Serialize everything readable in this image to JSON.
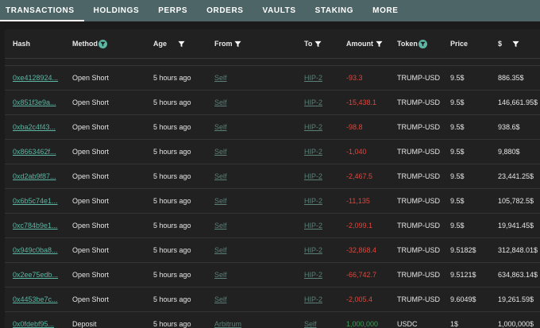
{
  "tabs": [
    {
      "label": "TRANSACTIONS",
      "active": true
    },
    {
      "label": "HOLDINGS",
      "active": false
    },
    {
      "label": "PERPS",
      "active": false
    },
    {
      "label": "ORDERS",
      "active": false
    },
    {
      "label": "VAULTS",
      "active": false
    },
    {
      "label": "STAKING",
      "active": false
    },
    {
      "label": "MORE",
      "active": false
    }
  ],
  "columns": {
    "hash": "Hash",
    "method": "Method",
    "age": "Age",
    "from": "From",
    "to": "To",
    "amount": "Amount",
    "token": "Token",
    "price": "Price",
    "usd": "$"
  },
  "rows": [
    {
      "hash": "0xe4128924...",
      "method": "Open Short",
      "age": "5 hours ago",
      "from": "Self",
      "to": "HIP-2",
      "amount": "-93.3",
      "amount_sign": "neg",
      "token": "TRUMP-USD",
      "price": "9.5$",
      "usd": "886.35$"
    },
    {
      "hash": "0x851f3e9a...",
      "method": "Open Short",
      "age": "5 hours ago",
      "from": "Self",
      "to": "HIP-2",
      "amount": "-15,438.1",
      "amount_sign": "neg",
      "token": "TRUMP-USD",
      "price": "9.5$",
      "usd": "146,661.95$"
    },
    {
      "hash": "0xba2c4f43...",
      "method": "Open Short",
      "age": "5 hours ago",
      "from": "Self",
      "to": "HIP-2",
      "amount": "-98.8",
      "amount_sign": "neg",
      "token": "TRUMP-USD",
      "price": "9.5$",
      "usd": "938.6$"
    },
    {
      "hash": "0x8663462f...",
      "method": "Open Short",
      "age": "5 hours ago",
      "from": "Self",
      "to": "HIP-2",
      "amount": "-1,040",
      "amount_sign": "neg",
      "token": "TRUMP-USD",
      "price": "9.5$",
      "usd": "9,880$"
    },
    {
      "hash": "0xd2ab9f87...",
      "method": "Open Short",
      "age": "5 hours ago",
      "from": "Self",
      "to": "HIP-2",
      "amount": "-2,467.5",
      "amount_sign": "neg",
      "token": "TRUMP-USD",
      "price": "9.5$",
      "usd": "23,441.25$"
    },
    {
      "hash": "0x6b5c74e1...",
      "method": "Open Short",
      "age": "5 hours ago",
      "from": "Self",
      "to": "HIP-2",
      "amount": "-11,135",
      "amount_sign": "neg",
      "token": "TRUMP-USD",
      "price": "9.5$",
      "usd": "105,782.5$"
    },
    {
      "hash": "0xc784b9e1...",
      "method": "Open Short",
      "age": "5 hours ago",
      "from": "Self",
      "to": "HIP-2",
      "amount": "-2,099.1",
      "amount_sign": "neg",
      "token": "TRUMP-USD",
      "price": "9.5$",
      "usd": "19,941.45$"
    },
    {
      "hash": "0x949c0ba8...",
      "method": "Open Short",
      "age": "5 hours ago",
      "from": "Self",
      "to": "HIP-2",
      "amount": "-32,868.4",
      "amount_sign": "neg",
      "token": "TRUMP-USD",
      "price": "9.5182$",
      "usd": "312,848.01$"
    },
    {
      "hash": "0x2ee75edb...",
      "method": "Open Short",
      "age": "5 hours ago",
      "from": "Self",
      "to": "HIP-2",
      "amount": "-66,742.7",
      "amount_sign": "neg",
      "token": "TRUMP-USD",
      "price": "9.5121$",
      "usd": "634,863.14$"
    },
    {
      "hash": "0x4453be7c...",
      "method": "Open Short",
      "age": "5 hours ago",
      "from": "Self",
      "to": "HIP-2",
      "amount": "-2,005.4",
      "amount_sign": "neg",
      "token": "TRUMP-USD",
      "price": "9.6049$",
      "usd": "19,261.59$"
    },
    {
      "hash": "0x0fdebf95...",
      "method": "Deposit",
      "age": "5 hours ago",
      "from": "Arbitrum",
      "to": "Self",
      "amount": "1,000,000",
      "amount_sign": "pos",
      "token": "USDC",
      "price": "1$",
      "usd": "1,000,000$"
    }
  ],
  "colors": {
    "tabbar": "#4d6566",
    "accent": "#5db7a4",
    "negative": "#e2453c",
    "positive": "#3aa055"
  }
}
